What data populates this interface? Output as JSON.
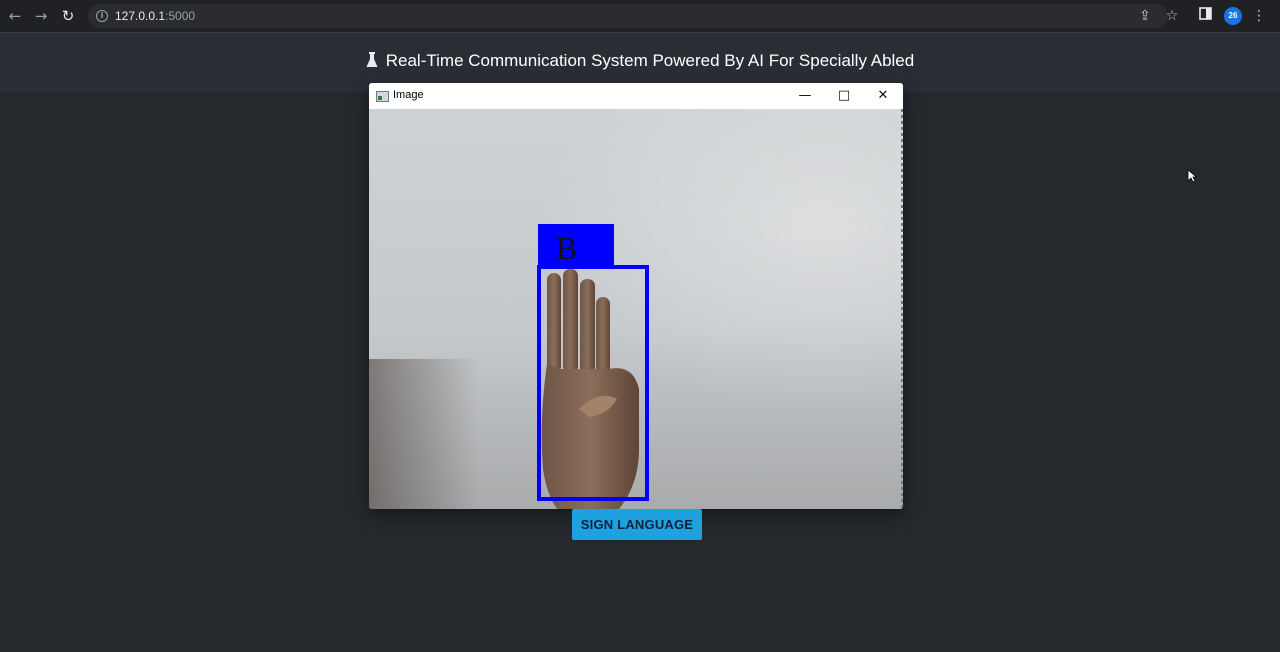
{
  "browser": {
    "url_host": "127.0.0.1",
    "url_port": ":5000",
    "profile_initials": "26"
  },
  "page": {
    "title": "Real-Time Communication System Powered By AI For Specially Abled"
  },
  "image_window": {
    "title": "Image",
    "minimize_glyph": "—",
    "maximize_glyph": "□",
    "close_glyph": "✕",
    "detected_letter": "B"
  },
  "actions": {
    "sign_language_label": "SIGN LANGUAGE"
  },
  "colors": {
    "detection": "#0000ff",
    "button": "#1ea1e0",
    "background": "#25292e"
  }
}
